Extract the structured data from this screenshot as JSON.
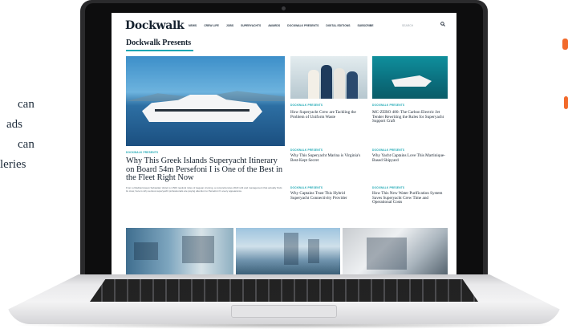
{
  "side_text": [
    "can",
    "ads",
    "can",
    "leries"
  ],
  "site": {
    "logo": "Dockwalk",
    "nav": [
      "NEWS",
      "CREW LIFE",
      "JOBS",
      "SUPERYACHTS",
      "AWARDS",
      "DOCKWALK PRESENTS",
      "DIGITAL EDITIONS",
      "SUBSCRIBE"
    ],
    "search_label": "SEARCH",
    "section_title": "Dockwalk Presents"
  },
  "hero": {
    "kicker": "DOCKWALK PRESENTS",
    "title": "Why This Greek Islands Superyacht Itinerary on Board 54m Persefoni I is One of the Best in the Fleet Right Now",
    "dek": "From a Mediterranean Sebastian Vettel to 4,500 nautical miles of Aegean cruising, a comprehensive 2023 refit and management that actually finds its crew, here is why serious superyacht professionals are paying attention to Persefoni I's every appearance."
  },
  "cards": [
    {
      "kicker": "DOCKWALK PRESENTS",
      "title": "How Superyacht Crew are Tackling the Problem of Uniform Waste"
    },
    {
      "kicker": "DOCKWALK PRESENTS",
      "title": "MC-ZERO 480: The Carbon Electric Jet Tender Rewriting the Rules for Superyacht Support Craft"
    },
    {
      "kicker": "DOCKWALK PRESENTS",
      "title": "Why This Superyacht Marina is Virginia's Best-Kept Secret"
    },
    {
      "kicker": "DOCKWALK PRESENTS",
      "title": "Why Yacht Captains Love This Martinique-Based Shipyard"
    },
    {
      "kicker": "DOCKWALK PRESENTS",
      "title": "Why Captains Trust This Hybrid Superyacht Connectivity Provider"
    },
    {
      "kicker": "DOCKWALK PRESENTS",
      "title": "How This New Water Purification System Saves Superyacht Crew Time and Operational Costs"
    }
  ],
  "colors": {
    "accent": "#1ba7b3",
    "ink": "#14202d",
    "orange": "#f26a2b"
  },
  "icons": {
    "search": "search-icon"
  }
}
